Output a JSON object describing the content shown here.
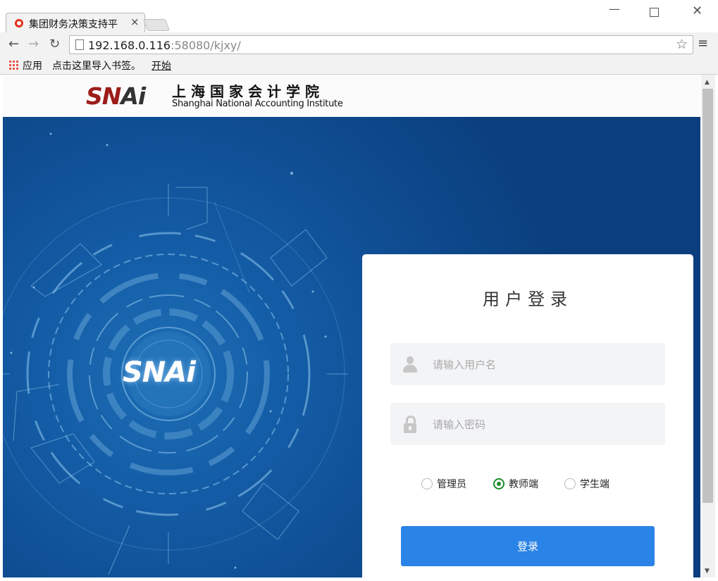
{
  "browser": {
    "tab_title": "集团财务决策支持平",
    "tab_close": "×",
    "url_host": "192.168.0.116",
    "url_rest": ":58080/kjxy/",
    "bookmarks": {
      "apps": "应用",
      "import": "点击这里导入书签。",
      "start": "开始"
    },
    "icons": [
      "favicon-icon",
      "back-icon",
      "forward-icon",
      "reload-icon",
      "page-icon",
      "star-icon",
      "menu-icon",
      "apps-grid-icon",
      "minimize-icon",
      "maximize-icon",
      "close-icon"
    ]
  },
  "header": {
    "logo_text_a": "SN",
    "logo_text_b": "Ai",
    "name_cn": "上海国家会计学院",
    "name_en": "Shanghai National Accounting Institute"
  },
  "hero": {
    "logo_text": "SNAi"
  },
  "login": {
    "title": "用户登录",
    "username_placeholder": "请输入用户名",
    "password_placeholder": "请输入密码",
    "roles": [
      {
        "label": "管理员",
        "checked": false
      },
      {
        "label": "教师端",
        "checked": true
      },
      {
        "label": "学生端",
        "checked": false
      }
    ],
    "submit_label": "登录"
  },
  "colors": {
    "accent": "#2a83e6",
    "radio_checked": "#1a8c2e",
    "hero_blue": "#145ea8",
    "logo_red": "#9c1d1a"
  }
}
